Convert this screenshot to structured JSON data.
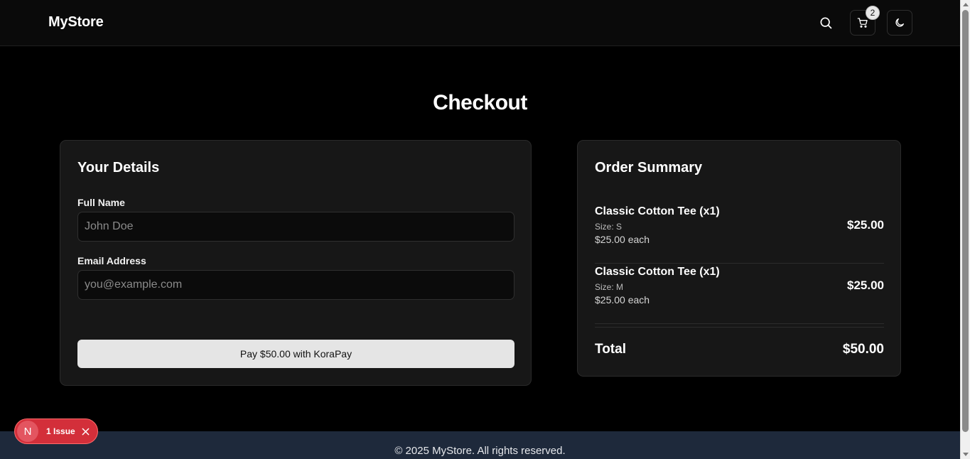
{
  "header": {
    "logo": "MyStore",
    "cart_count": "2"
  },
  "page": {
    "title": "Checkout"
  },
  "details": {
    "title": "Your Details",
    "full_name_label": "Full Name",
    "full_name_placeholder": "John Doe",
    "email_label": "Email Address",
    "email_placeholder": "you@example.com",
    "pay_button": "Pay $50.00 with KoraPay"
  },
  "summary": {
    "title": "Order Summary",
    "items": [
      {
        "name": "Classic Cotton Tee (x1)",
        "size": "Size: S",
        "each": "$25.00 each",
        "price": "$25.00"
      },
      {
        "name": "Classic Cotton Tee (x1)",
        "size": "Size: M",
        "each": "$25.00 each",
        "price": "$25.00"
      }
    ],
    "total_label": "Total",
    "total_value": "$50.00"
  },
  "footer": {
    "text": "© 2025 MyStore. All rights reserved."
  },
  "issue_badge": {
    "letter": "N",
    "text": "1 Issue"
  },
  "colors": {
    "background": "#000000",
    "card": "#171717",
    "footer": "#1e293b",
    "issue_red": "#d32f3a",
    "pay_button": "#e5e5e5"
  },
  "icons": {
    "search": "search-icon",
    "cart": "cart-icon",
    "theme": "moon-icon",
    "issue_close": "close-icon"
  }
}
